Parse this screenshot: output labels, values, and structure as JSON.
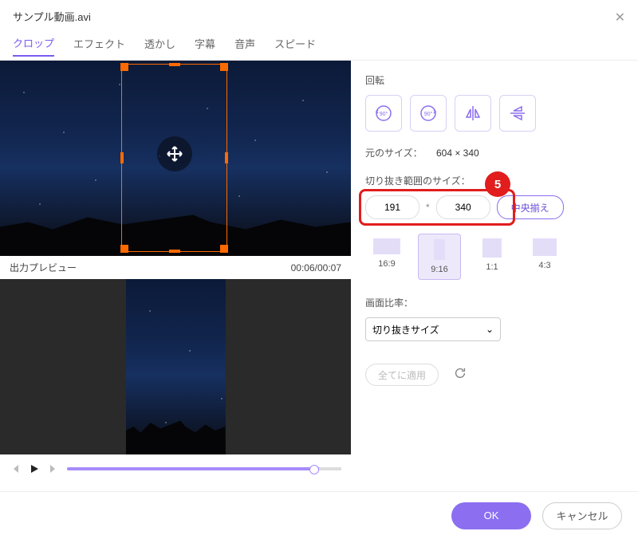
{
  "header": {
    "filename": "サンプル動画.avi"
  },
  "tabs": [
    "クロップ",
    "エフェクト",
    "透かし",
    "字幕",
    "音声",
    "スピード"
  ],
  "active_tab": 0,
  "preview": {
    "output_label": "出力プレビュー",
    "time_current": "00:06",
    "time_total": "00:07"
  },
  "rotation": {
    "label": "回転"
  },
  "original_size": {
    "label": "元のサイズ：",
    "value": "604 × 340"
  },
  "crop_size": {
    "label": "切り抜き範囲のサイズ：",
    "width": "191",
    "height": "340",
    "center_btn": "中央揃え"
  },
  "annotation": {
    "badge": "5"
  },
  "aspect_ratios": [
    {
      "key": "16:9",
      "shape": "s169"
    },
    {
      "key": "9:16",
      "shape": "s916"
    },
    {
      "key": "1:1",
      "shape": "s11"
    },
    {
      "key": "4:3",
      "shape": "s43"
    }
  ],
  "aspect_selected": 1,
  "screen_ratio": {
    "label": "画面比率：",
    "selected": "切り抜きサイズ"
  },
  "apply_all": "全てに適用",
  "footer": {
    "ok": "OK",
    "cancel": "キャンセル"
  }
}
